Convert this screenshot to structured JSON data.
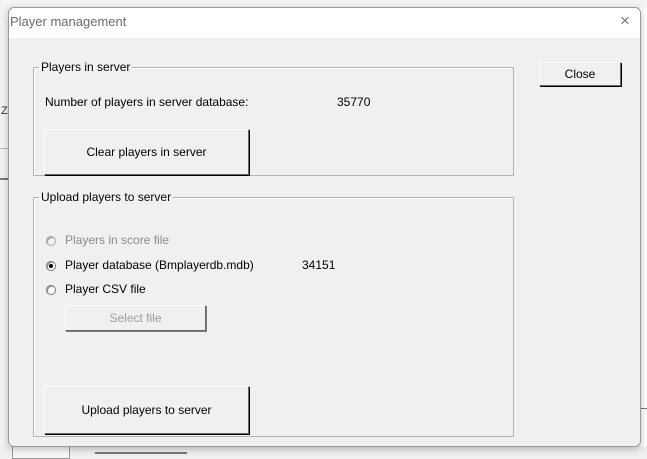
{
  "dialog": {
    "title": "Player management",
    "close_glyph": "×",
    "close_button": "Close"
  },
  "players_in_server": {
    "legend": "Players in server",
    "count_label": "Number of players in server database:",
    "count_value": "35770",
    "clear_button": "Clear players in server"
  },
  "upload": {
    "legend": "Upload players to server",
    "options": [
      {
        "label": "Players in score file",
        "selected": false,
        "enabled": false
      },
      {
        "label": "Player database (Bmplayerdb.mdb)",
        "selected": true,
        "enabled": true,
        "count": "34151"
      },
      {
        "label": "Player CSV file",
        "selected": false,
        "enabled": true
      }
    ],
    "select_file_button": "Select file",
    "upload_button": "Upload players to server"
  },
  "background": {
    "fragment_letter": "Z"
  }
}
